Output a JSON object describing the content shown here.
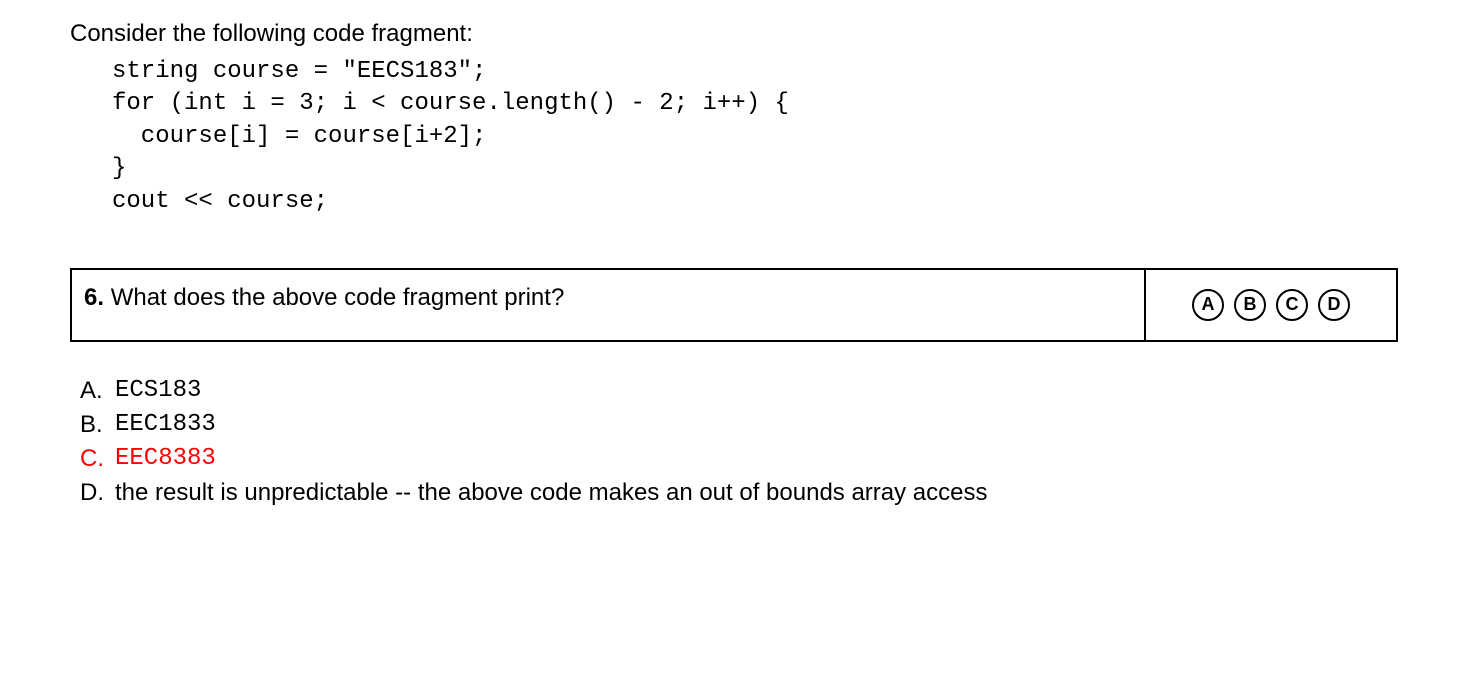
{
  "intro": "Consider the following code fragment:",
  "code": "string course = \"EECS183\";\nfor (int i = 3; i < course.length() - 2; i++) {\n  course[i] = course[i+2];\n}\ncout << course;",
  "question": {
    "number": "6.",
    "text": "What does the above code fragment print?"
  },
  "bubbles": [
    "A",
    "B",
    "C",
    "D"
  ],
  "options": [
    {
      "letter": "A.",
      "text": "ECS183",
      "mono": true,
      "correct": false
    },
    {
      "letter": "B.",
      "text": "EEC1833",
      "mono": true,
      "correct": false
    },
    {
      "letter": "C.",
      "text": "EEC8383",
      "mono": true,
      "correct": true
    },
    {
      "letter": "D.",
      "text": "the result is unpredictable -- the above code makes an out of bounds array access",
      "mono": false,
      "correct": false
    }
  ]
}
